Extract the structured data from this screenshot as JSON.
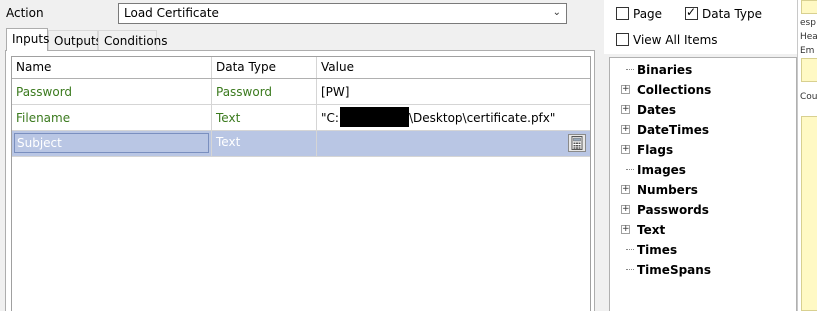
{
  "action": {
    "label": "Action",
    "value": "Load Certificate"
  },
  "tabs": [
    {
      "label": "Inputs",
      "active": true
    },
    {
      "label": "Outputs",
      "active": false
    },
    {
      "label": "Conditions",
      "active": false
    }
  ],
  "grid": {
    "columns": [
      "Name",
      "Data Type",
      "Value"
    ],
    "rows": [
      {
        "name": "Password",
        "type": "Password",
        "value": "[PW]"
      },
      {
        "name": "Filename",
        "type": "Text",
        "value_prefix": "\"C:",
        "value_suffix": "\\Desktop\\certificate.pfx\""
      },
      {
        "name": "Subject",
        "type": "Text",
        "value": "",
        "selected": true
      }
    ]
  },
  "filters": {
    "page": {
      "label": "Page",
      "checked": false
    },
    "data_type": {
      "label": "Data Type",
      "checked": true
    },
    "view_all": {
      "label": "View All Items",
      "checked": false
    }
  },
  "tree": [
    {
      "label": "Binaries",
      "expandable": false
    },
    {
      "label": "Collections",
      "expandable": true
    },
    {
      "label": "Dates",
      "expandable": true
    },
    {
      "label": "DateTimes",
      "expandable": true
    },
    {
      "label": "Flags",
      "expandable": true
    },
    {
      "label": "Images",
      "expandable": false
    },
    {
      "label": "Numbers",
      "expandable": true
    },
    {
      "label": "Passwords",
      "expandable": true
    },
    {
      "label": "Text",
      "expandable": true
    },
    {
      "label": "Times",
      "expandable": false
    },
    {
      "label": "TimeSpans",
      "expandable": false
    }
  ],
  "strip": {
    "t1": "esp",
    "t2": "Head",
    "t3": "Em",
    "t4": "Cou"
  },
  "icons": {
    "combo": "chevron-down-icon",
    "calc": "calculator-icon",
    "expand": "plus-icon",
    "check": "checkmark-icon"
  }
}
